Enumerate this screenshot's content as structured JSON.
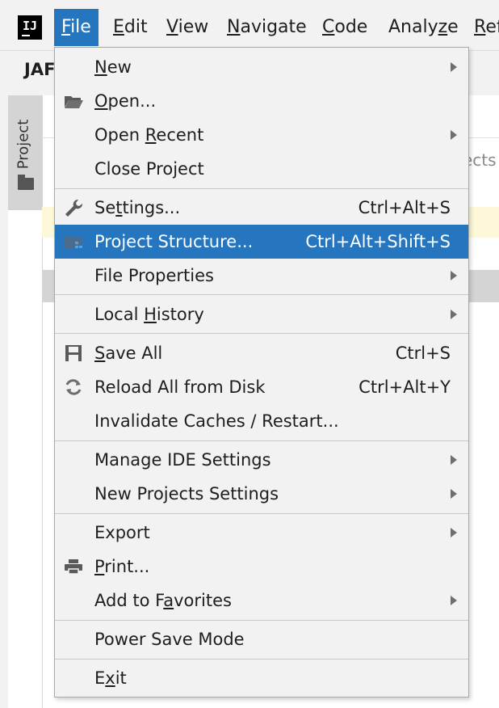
{
  "menubar": {
    "logo": "IJ",
    "menus": [
      {
        "pre": "",
        "mn": "F",
        "post": "ile"
      },
      {
        "pre": "",
        "mn": "E",
        "post": "dit"
      },
      {
        "pre": "",
        "mn": "V",
        "post": "iew"
      },
      {
        "pre": "",
        "mn": "N",
        "post": "avigate"
      },
      {
        "pre": "",
        "mn": "C",
        "post": "ode"
      },
      {
        "pre": "Analy",
        "mn": "z",
        "post": "e"
      },
      {
        "pre": "",
        "mn": "R",
        "post": "ef"
      }
    ]
  },
  "background": {
    "project_name": "JAF",
    "project_tab": "Project",
    "partial_text": "ects"
  },
  "file_menu": {
    "items": [
      {
        "pre": "",
        "mn": "N",
        "post": "ew",
        "shortcut": "",
        "submenu": true,
        "icon": ""
      },
      {
        "pre": "",
        "mn": "O",
        "post": "pen...",
        "shortcut": "",
        "submenu": false,
        "icon": "open-folder-icon"
      },
      {
        "pre": "Open ",
        "mn": "R",
        "post": "ecent",
        "shortcut": "",
        "submenu": true,
        "icon": ""
      },
      {
        "pre": "Close Project",
        "mn": "",
        "post": "",
        "shortcut": "",
        "submenu": false,
        "icon": ""
      },
      {
        "pre": "Se",
        "mn": "t",
        "post": "tings...",
        "shortcut": "Ctrl+Alt+S",
        "submenu": false,
        "icon": "wrench-icon"
      },
      {
        "pre": "Project Structure...",
        "mn": "",
        "post": "",
        "shortcut": "Ctrl+Alt+Shift+S",
        "submenu": false,
        "icon": "project-structure-icon"
      },
      {
        "pre": "File Properties",
        "mn": "",
        "post": "",
        "shortcut": "",
        "submenu": true,
        "icon": ""
      },
      {
        "pre": "Local ",
        "mn": "H",
        "post": "istory",
        "shortcut": "",
        "submenu": true,
        "icon": ""
      },
      {
        "pre": "",
        "mn": "S",
        "post": "ave All",
        "shortcut": "Ctrl+S",
        "submenu": false,
        "icon": "save-icon"
      },
      {
        "pre": "Reload All from Disk",
        "mn": "",
        "post": "",
        "shortcut": "Ctrl+Alt+Y",
        "submenu": false,
        "icon": "reload-icon"
      },
      {
        "pre": "Invalidate Caches / Restart...",
        "mn": "",
        "post": "",
        "shortcut": "",
        "submenu": false,
        "icon": ""
      },
      {
        "pre": "Manage IDE Settings",
        "mn": "",
        "post": "",
        "shortcut": "",
        "submenu": true,
        "icon": ""
      },
      {
        "pre": "New Projects Settings",
        "mn": "",
        "post": "",
        "shortcut": "",
        "submenu": true,
        "icon": ""
      },
      {
        "pre": "Export",
        "mn": "",
        "post": "",
        "shortcut": "",
        "submenu": true,
        "icon": ""
      },
      {
        "pre": "",
        "mn": "P",
        "post": "rint...",
        "shortcut": "",
        "submenu": false,
        "icon": "print-icon"
      },
      {
        "pre": "Add to F",
        "mn": "a",
        "post": "vorites",
        "shortcut": "",
        "submenu": true,
        "icon": ""
      },
      {
        "pre": "Power Save Mode",
        "mn": "",
        "post": "",
        "shortcut": "",
        "submenu": false,
        "icon": ""
      },
      {
        "pre": "E",
        "mn": "x",
        "post": "it",
        "shortcut": "",
        "submenu": false,
        "icon": ""
      }
    ]
  },
  "colors": {
    "accent": "#2675bf",
    "menu_bg": "#f2f2f2"
  }
}
